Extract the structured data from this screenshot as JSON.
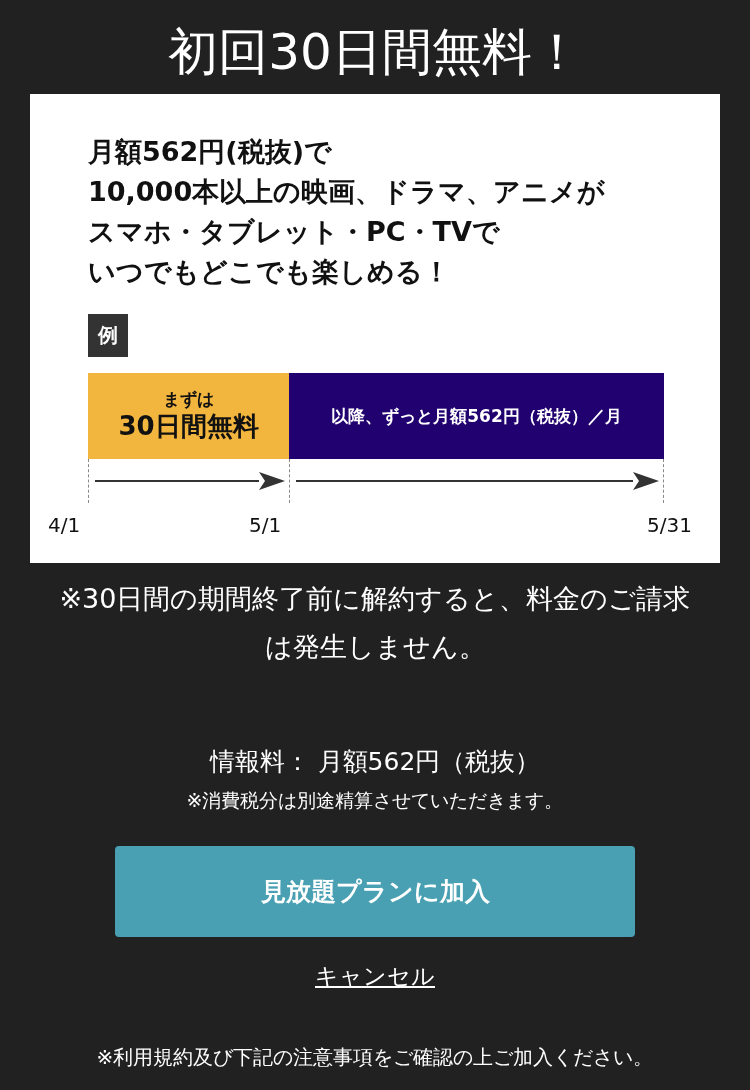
{
  "title": "初回30日間無料！",
  "banner": {
    "headline": [
      "月額562円(税抜)で",
      "10,000本以上の映画、ドラマ、アニメが",
      "スマホ・タブレット・PC・TVで",
      "いつでもどこでも楽しめる！"
    ],
    "example_label": "例",
    "segments": [
      {
        "kind": "free",
        "color": "#f2b53e",
        "lines": [
          "まずは",
          "30日間無料"
        ]
      },
      {
        "kind": "paid",
        "color": "#210070",
        "lines": [
          "以降、ずっと月額562円（税抜）／月"
        ]
      }
    ],
    "dates": [
      "4/1",
      "5/1",
      "5/31"
    ]
  },
  "notice": "※30日間の期間終了前に解約すると、料金のご請求は発生しません。",
  "price": "情報料： 月額562円（税抜）",
  "tax_note": "※消費税分は別途精算させていただきます。",
  "join_button": "見放題プランに加入",
  "cancel_link": "キャンセル",
  "footer_note": "※利用規約及び下記の注意事項をご確認の上ご加入ください。"
}
